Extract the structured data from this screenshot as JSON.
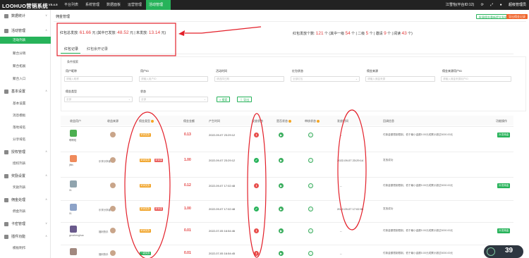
{
  "app": {
    "title": "LOOHUO营销系统",
    "version": "V5.4.5"
  },
  "nav": {
    "items": [
      "平台列表",
      "系统管理",
      "数据面板",
      "运营管理",
      "活动管理"
    ],
    "active": "活动管理"
  },
  "topright": {
    "account": "江雪怡(平台ID:12)",
    "user": "超级管理员"
  },
  "sidebar": {
    "groups": [
      {
        "label": "数据统计",
        "items": []
      },
      {
        "label": "活动管理",
        "items": [
          "活动列表",
          "聚合分销",
          "聚合拓展",
          "聚合入口"
        ]
      },
      {
        "label": "基本设置",
        "items": [
          "基本设置",
          "消息模板",
          "落地域名",
          "分享域名"
        ]
      },
      {
        "label": "授权管理",
        "items": [
          "授权列表"
        ]
      },
      {
        "label": "奖励设置",
        "items": [
          "奖励列表"
        ]
      },
      {
        "label": "佣金处理",
        "items": [
          "佣金列表"
        ]
      },
      {
        "label": "卡密管理",
        "items": []
      },
      {
        "label": "插件功能",
        "items": [
          "模板制作"
        ]
      }
    ],
    "active_item": "活动列表"
  },
  "page": {
    "title": "佣金管理",
    "btn_batch": "批量佣金重新提交发放",
    "btn_export": "导出佣金记录"
  },
  "stats": {
    "left": {
      "l1": "红包总发放:",
      "total": "61.66",
      "l2": "元 (其中已发放:",
      "sent": "48.52",
      "l3": "元 | 未发放:",
      "unsent": "13.14",
      "l4": "元)"
    },
    "right": {
      "l1": "红包发放个数:",
      "total": "121",
      "l2": "个 (其中一级",
      "lv1": "54",
      "l3": "个 | 二级",
      "lv2": "5",
      "l4": "个 | 邀请",
      "invite": "9",
      "l5": "个 | 阅读",
      "read": "43",
      "l6": "个)"
    }
  },
  "tabs": [
    "红包记录",
    "红包余开记录"
  ],
  "filter": {
    "title": "条件搜索",
    "fields": [
      {
        "label": "用户昵称",
        "placeholder": "请输入昵称"
      },
      {
        "label": "用户ID",
        "placeholder": "请输入用户ID"
      },
      {
        "label": "活动时间",
        "placeholder": "请选择日期"
      },
      {
        "label": "红包状态",
        "placeholder": "全部红包"
      },
      {
        "label": "佣金来源",
        "placeholder": "请输入佣金来源"
      },
      {
        "label": "佣金来源用户ID",
        "placeholder": "请输入佣金来源用户ID"
      },
      {
        "label": "佣金类型",
        "placeholder": "全部"
      },
      {
        "label": "状态",
        "placeholder": "全部"
      }
    ],
    "btn_search": "搜索",
    "btn_export": "导出"
  },
  "table": {
    "headers": [
      "收益用户",
      "收益来源",
      "佣金类型",
      "佣金金额",
      "产生时间",
      "发放状态",
      "是否状态",
      "审核状态",
      "发放时间",
      "回调信息",
      "功能操作"
    ],
    "rows": [
      {
        "user": "啊啊啦",
        "source_user": "",
        "types": [
          "阅读奖励"
        ],
        "amount": "0.13",
        "time": "2022-09-07 23:29:12",
        "status": "fail",
        "send_time": "--",
        "remark": "付款金额限制限制，低于最小金额0.00元或累计超过5000.00元",
        "action": "补发佣金"
      },
      {
        "user": "jfkls",
        "source_user": "乐享分享者",
        "types": [
          "阅读奖励",
          "阅读量"
        ],
        "amount": "1.00",
        "time": "2022-09-07 23:29:12",
        "status": "ok",
        "send_time": "2022-09-07 23:29:14",
        "remark": "发放成功",
        "action": ""
      },
      {
        "user": "01",
        "source_user": "",
        "types": [
          "阅读奖励"
        ],
        "amount": "0.12",
        "time": "2022-09-07 17:02:48",
        "status": "fail",
        "send_time": "--",
        "remark": "付款金额限制限制，低于最小金额0.00元或累计超过5000.00元",
        "action": "补发佣金"
      },
      {
        "user": "01",
        "source_user": "乐享分享者",
        "types": [
          "阅读奖励",
          "阅读量"
        ],
        "amount": "1.00",
        "time": "2022-09-07 17:02:48",
        "status": "ok",
        "send_time": "2022-09-07 17:02:50",
        "remark": "发放成功",
        "action": ""
      },
      {
        "user": "geozhenghua",
        "source_user": "福利快手",
        "types": [
          "阅读奖励"
        ],
        "amount": "0.01",
        "time": "2022-07-05 16:54:46",
        "status": "fail",
        "send_time": "--",
        "remark": "付款金额限制限制，低于最小金额0.00元或累计超过5000.00元",
        "action": "补发佣金"
      },
      {
        "user": "",
        "source_user": "福利快手",
        "types": [
          "一级奖励"
        ],
        "amount": "0.01",
        "time": "2022-07-05 16:54:45",
        "status": "fail",
        "send_time": "--",
        "remark": "付款金额限制限制，低于最小金额0.00元或累计超过5000.00元",
        "action": ""
      }
    ]
  },
  "speed_widget": {
    "value": "39"
  },
  "colors": {
    "accent": "#27b35a",
    "danger": "#e23b3b",
    "annotation": "#e3202a"
  }
}
